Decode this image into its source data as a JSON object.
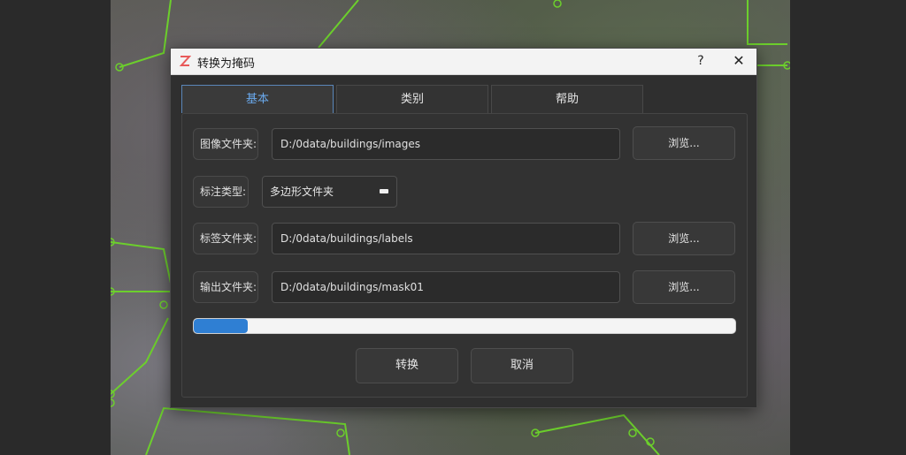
{
  "dialog": {
    "title": "转换为掩码",
    "help_label": "?",
    "close_label": "✕"
  },
  "tabs": [
    {
      "label": "基本",
      "active": true
    },
    {
      "label": "类别",
      "active": false
    },
    {
      "label": "帮助",
      "active": false
    }
  ],
  "form": {
    "image_folder": {
      "label": "图像文件夹:",
      "value": "D:/0data/buildings/images",
      "browse_label": "浏览..."
    },
    "annotation_type": {
      "label": "标注类型:",
      "value": "多边形文件夹"
    },
    "label_folder": {
      "label": "标签文件夹:",
      "value": "D:/0data/buildings/labels",
      "browse_label": "浏览..."
    },
    "output_folder": {
      "label": "输出文件夹:",
      "value": "D:/0data/buildings/mask01",
      "browse_label": "浏览..."
    }
  },
  "progress": {
    "fraction": 0.1
  },
  "actions": {
    "convert_label": "转换",
    "cancel_label": "取消"
  },
  "colors": {
    "accent": "#2f7fd3",
    "annotation_outline": "#6ccf2c",
    "logo": "#e85a5a"
  },
  "icons": {
    "app_logo": "z-logo-icon",
    "help": "help-icon",
    "close": "close-icon",
    "combo_arrow": "dropdown-icon"
  }
}
